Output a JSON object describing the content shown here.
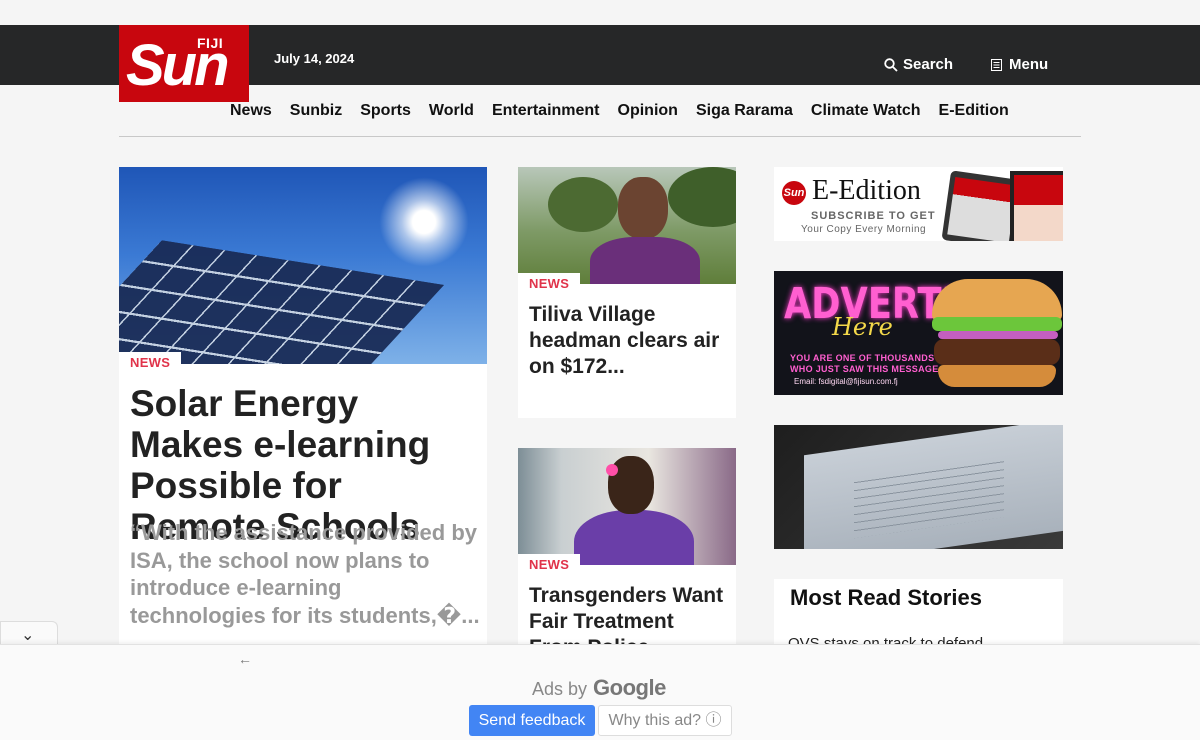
{
  "header": {
    "logo_small": "FIJI",
    "logo_main": "Sun",
    "date": "July 14, 2024",
    "search_label": "Search",
    "menu_label": "Menu"
  },
  "nav": {
    "items": [
      "News",
      "Sunbiz",
      "Sports",
      "World",
      "Entertainment",
      "Opinion",
      "Siga Rarama",
      "Climate Watch",
      "E-Edition"
    ]
  },
  "main_story": {
    "category": "NEWS",
    "title": "Solar Energy Makes e-learning Possible for Remote Schools",
    "excerpt": "“With the assistance provided by ISA, the school now plans to introduce e-learning technologies for its students,�..."
  },
  "mid_stories": [
    {
      "category": "NEWS",
      "title": "Tiliva Village headman clears air on $172..."
    },
    {
      "category": "NEWS",
      "title": "Transgenders Want Fair Treatment From Police"
    }
  ],
  "ads": {
    "eedition": {
      "logo": "Sun",
      "title": "E-Edition",
      "subtitle": "SUBSCRIBE TO GET",
      "tagline": "Your Copy Every Morning"
    },
    "advertise": {
      "headline": "ADVERTISE",
      "script": "Here",
      "line1": "YOU ARE ONE OF THOUSANDS",
      "line2": "WHO JUST SAW THIS MESSAGE",
      "email": "Email: fsdigital@fijisun.com.fj"
    }
  },
  "most_read": {
    "heading": "Most Read Stories",
    "first_item": "OVS stays on track to defend"
  },
  "ad_bar": {
    "ads_by": "Ads by",
    "google": "Google",
    "feedback": "Send feedback",
    "why": "Why this ad? ⓘ",
    "back": "←",
    "collapse": "⌄"
  },
  "colors": {
    "brand_red": "#c8060e",
    "topbar": "#262728",
    "category": "#e0334a",
    "feedback_blue": "#4285f4"
  }
}
